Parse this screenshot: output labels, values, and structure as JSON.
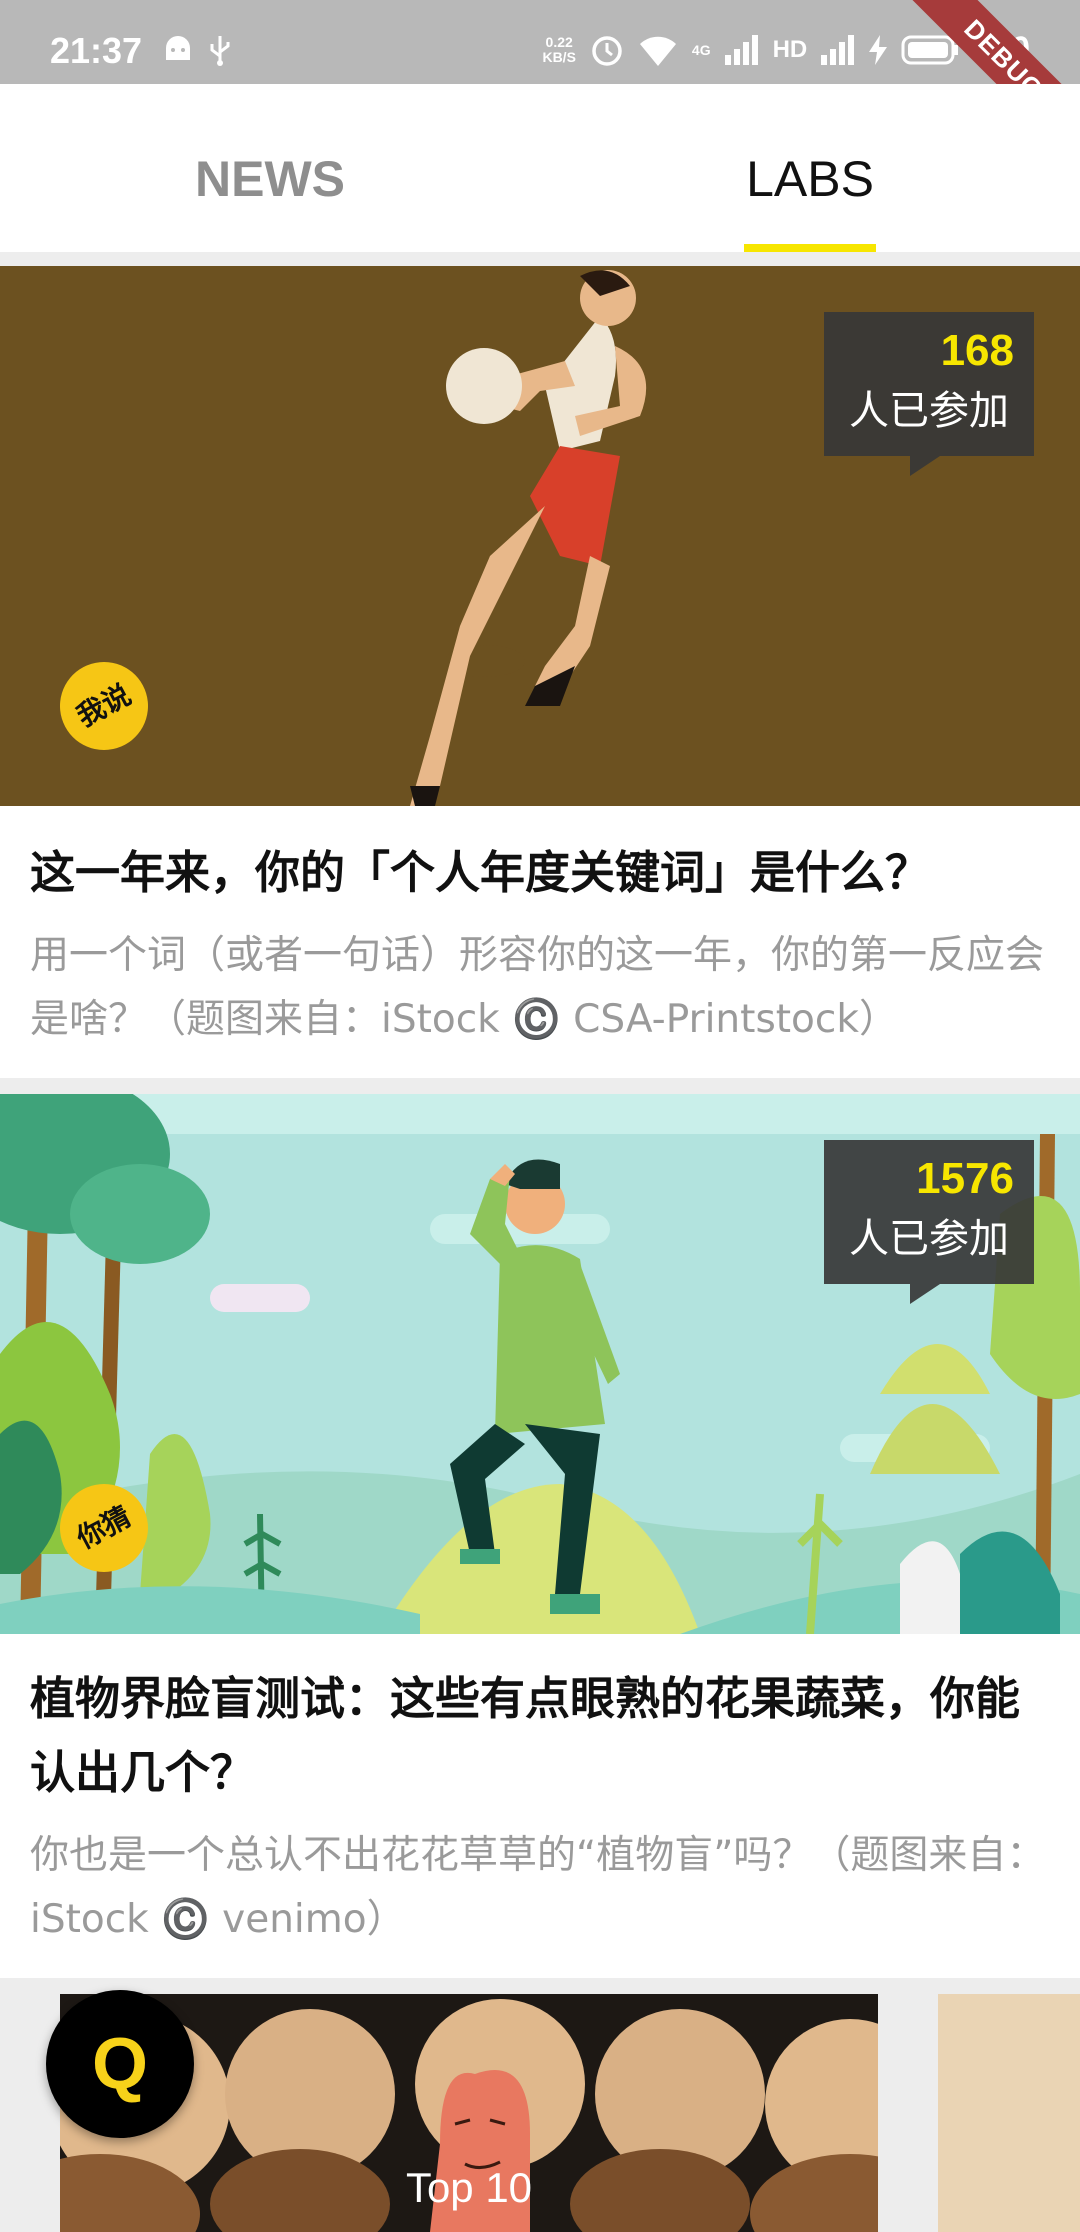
{
  "status_bar": {
    "time": "21:37",
    "net_speed_value": "0.22",
    "net_speed_unit": "KB/S",
    "network_type": "4G",
    "hd_label": "HD",
    "battery": "100",
    "debug_banner": "DEBUG",
    "icons": [
      "android-icon",
      "usb-icon",
      "alarm-icon",
      "wifi-icon",
      "signal-icon",
      "charging-icon",
      "battery-icon"
    ]
  },
  "tabs": [
    {
      "label": "NEWS",
      "active": false
    },
    {
      "label": "LABS",
      "active": true
    }
  ],
  "accent_color": "#f7e600",
  "cards": [
    {
      "count": "168",
      "count_label": "人已参加",
      "badge": "我说",
      "title": "这一年来，你的「个人年度关键词」是什么？",
      "description": "用一个词（或者一句话）形容你的这一年，你的第一反应会是啥？（题图来自：iStock ©️ CSA-Printstock）"
    },
    {
      "count": "1576",
      "count_label": "人已参加",
      "badge": "你猜",
      "title": "植物界脸盲测试：这些有点眼熟的花果蔬菜，你能认出几个？",
      "description": "你也是一个总认不出花花草草的“植物盲”吗？（题图来自：iStock ©️ venimo）"
    }
  ],
  "carousel": {
    "slide_title": "Top 10"
  },
  "fab": {
    "label": "Q"
  }
}
